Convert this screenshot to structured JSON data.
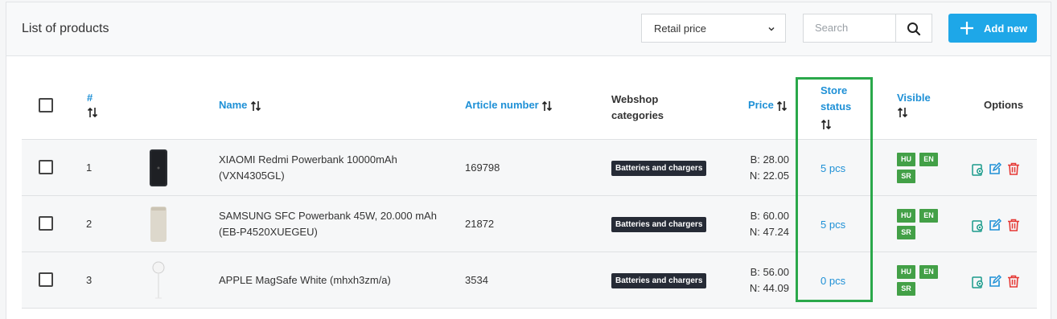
{
  "header": {
    "title": "List of products",
    "price_select": {
      "value": "Retail price"
    },
    "search": {
      "placeholder": "Search"
    },
    "add_button": "Add new"
  },
  "table": {
    "columns": {
      "number": "#",
      "name": "Name",
      "article": "Article number",
      "webshop_line1": "Webshop",
      "webshop_line2": "categories",
      "price": "Price",
      "store_line1": "Store",
      "store_line2": "status",
      "visible": "Visible",
      "options": "Options"
    },
    "rows": [
      {
        "num": "1",
        "name_line1": "XIAOMI Redmi Powerbank 10000mAh",
        "name_line2": "(VXN4305GL)",
        "article": "169798",
        "category": "Batteries and chargers",
        "price_b": "B: 28.00",
        "price_n": "N: 22.05",
        "store": "5 pcs",
        "langs": [
          "HU",
          "EN",
          "SR"
        ]
      },
      {
        "num": "2",
        "name_line1": "SAMSUNG SFC Powerbank 45W, 20.000 mAh",
        "name_line2": "(EB-P4520XUEGEU)",
        "article": "21872",
        "category": "Batteries and chargers",
        "price_b": "B: 60.00",
        "price_n": "N: 47.24",
        "store": "5 pcs",
        "langs": [
          "HU",
          "EN",
          "SR"
        ]
      },
      {
        "num": "3",
        "name_line1": "APPLE MagSafe White (mhxh3zm/a)",
        "name_line2": "",
        "article": "3534",
        "category": "Batteries and chargers",
        "price_b": "B: 56.00",
        "price_n": "N: 44.09",
        "store": "0 pcs",
        "langs": [
          "HU",
          "EN",
          "SR"
        ]
      }
    ]
  },
  "colors": {
    "accent": "#1ea7e8",
    "link": "#1e90d6",
    "lang_badge": "#43a047",
    "highlight": "#2aa84a",
    "delete": "#e53935",
    "view": "#1a9a8a"
  }
}
